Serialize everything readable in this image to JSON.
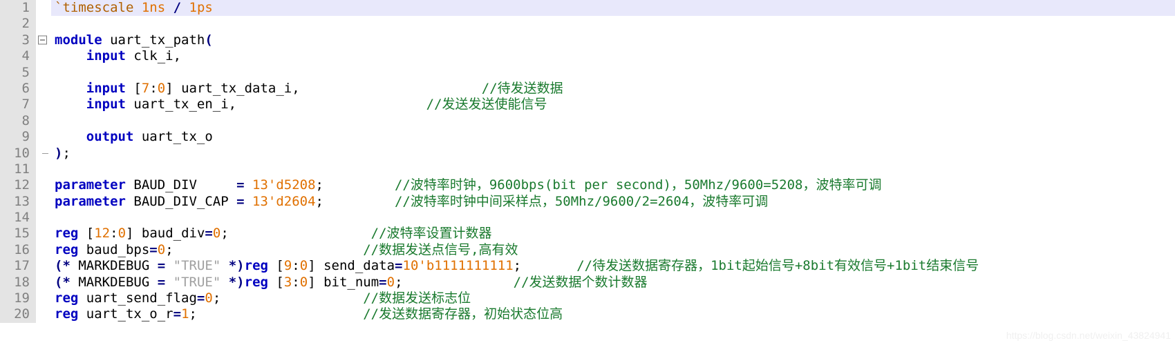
{
  "editor": {
    "language": "verilog",
    "colors": {
      "keyword": "#0000c0",
      "number": "#e07000",
      "comment": "#1a7a2e",
      "string": "#a0a0a0",
      "gutter_bg": "#e4e4e4",
      "gutter_fg": "#808080",
      "highlight_line_bg": "#e8e8fb",
      "background": "#ffffff"
    },
    "watermark": "https://blog.csdn.net/weixin_43824941",
    "lines": [
      {
        "number": "1",
        "highlight": true,
        "fold": "none",
        "tokens": [
          {
            "t": "tick",
            "v": "`timescale "
          },
          {
            "t": "num",
            "v": "1ns"
          },
          {
            "t": "plain",
            "v": " "
          },
          {
            "t": "op",
            "v": "/"
          },
          {
            "t": "plain",
            "v": " "
          },
          {
            "t": "num",
            "v": "1ps"
          }
        ]
      },
      {
        "number": "2",
        "highlight": false,
        "fold": "none",
        "tokens": []
      },
      {
        "number": "3",
        "highlight": false,
        "fold": "start",
        "tokens": [
          {
            "t": "kw",
            "v": "module"
          },
          {
            "t": "plain",
            "v": " uart_tx_path"
          },
          {
            "t": "op",
            "v": "("
          }
        ]
      },
      {
        "number": "4",
        "highlight": false,
        "fold": "mid",
        "tokens": [
          {
            "t": "plain",
            "v": "    "
          },
          {
            "t": "kw",
            "v": "input"
          },
          {
            "t": "plain",
            "v": " clk_i,"
          }
        ]
      },
      {
        "number": "5",
        "highlight": false,
        "fold": "mid",
        "tokens": []
      },
      {
        "number": "6",
        "highlight": false,
        "fold": "mid",
        "tokens": [
          {
            "t": "plain",
            "v": "    "
          },
          {
            "t": "kw",
            "v": "input"
          },
          {
            "t": "plain",
            "v": " ["
          },
          {
            "t": "num",
            "v": "7"
          },
          {
            "t": "plain",
            "v": ":"
          },
          {
            "t": "num",
            "v": "0"
          },
          {
            "t": "plain",
            "v": "] uart_tx_data_i,"
          },
          {
            "t": "pad",
            "v": 23
          },
          {
            "t": "comment",
            "v": "//待发送数据"
          }
        ]
      },
      {
        "number": "7",
        "highlight": false,
        "fold": "mid",
        "tokens": [
          {
            "t": "plain",
            "v": "    "
          },
          {
            "t": "kw",
            "v": "input"
          },
          {
            "t": "plain",
            "v": " uart_tx_en_i,"
          },
          {
            "t": "pad",
            "v": 24
          },
          {
            "t": "comment",
            "v": "//发送发送使能信号"
          }
        ]
      },
      {
        "number": "8",
        "highlight": false,
        "fold": "mid",
        "tokens": []
      },
      {
        "number": "9",
        "highlight": false,
        "fold": "mid",
        "tokens": [
          {
            "t": "plain",
            "v": "    "
          },
          {
            "t": "kw",
            "v": "output"
          },
          {
            "t": "plain",
            "v": " uart_tx_o"
          }
        ]
      },
      {
        "number": "10",
        "highlight": false,
        "fold": "end",
        "tokens": [
          {
            "t": "op",
            "v": ")"
          },
          {
            "t": "plain",
            "v": ";"
          }
        ]
      },
      {
        "number": "11",
        "highlight": false,
        "fold": "none",
        "tokens": []
      },
      {
        "number": "12",
        "highlight": false,
        "fold": "none",
        "tokens": [
          {
            "t": "kw",
            "v": "parameter"
          },
          {
            "t": "plain",
            "v": " BAUD_DIV     "
          },
          {
            "t": "op",
            "v": "="
          },
          {
            "t": "plain",
            "v": " "
          },
          {
            "t": "num",
            "v": "13'd5208"
          },
          {
            "t": "plain",
            "v": ";"
          },
          {
            "t": "pad",
            "v": 9
          },
          {
            "t": "comment",
            "v": "//波特率时钟，9600bps(bit per second)，50Mhz/9600=5208，波特率可调"
          }
        ]
      },
      {
        "number": "13",
        "highlight": false,
        "fold": "none",
        "tokens": [
          {
            "t": "kw",
            "v": "parameter"
          },
          {
            "t": "plain",
            "v": " BAUD_DIV_CAP "
          },
          {
            "t": "op",
            "v": "="
          },
          {
            "t": "plain",
            "v": " "
          },
          {
            "t": "num",
            "v": "13'd2604"
          },
          {
            "t": "plain",
            "v": ";"
          },
          {
            "t": "pad",
            "v": 9
          },
          {
            "t": "comment",
            "v": "//波特率时钟中间采样点，50Mhz/9600/2=2604，波特率可调"
          }
        ]
      },
      {
        "number": "14",
        "highlight": false,
        "fold": "none",
        "tokens": []
      },
      {
        "number": "15",
        "highlight": false,
        "fold": "none",
        "tokens": [
          {
            "t": "kw",
            "v": "reg"
          },
          {
            "t": "plain",
            "v": " ["
          },
          {
            "t": "num",
            "v": "12"
          },
          {
            "t": "plain",
            "v": ":"
          },
          {
            "t": "num",
            "v": "0"
          },
          {
            "t": "plain",
            "v": "] baud_div"
          },
          {
            "t": "op",
            "v": "="
          },
          {
            "t": "num",
            "v": "0"
          },
          {
            "t": "plain",
            "v": ";"
          },
          {
            "t": "pad",
            "v": 18
          },
          {
            "t": "comment",
            "v": "//波特率设置计数器"
          }
        ]
      },
      {
        "number": "16",
        "highlight": false,
        "fold": "none",
        "tokens": [
          {
            "t": "kw",
            "v": "reg"
          },
          {
            "t": "plain",
            "v": " baud_bps"
          },
          {
            "t": "op",
            "v": "="
          },
          {
            "t": "num",
            "v": "0"
          },
          {
            "t": "plain",
            "v": ";"
          },
          {
            "t": "pad",
            "v": 24
          },
          {
            "t": "comment",
            "v": "//数据发送点信号,高有效"
          }
        ]
      },
      {
        "number": "17",
        "highlight": false,
        "fold": "none",
        "tokens": [
          {
            "t": "op",
            "v": "(*"
          },
          {
            "t": "plain",
            "v": " MARKDEBUG "
          },
          {
            "t": "op",
            "v": "="
          },
          {
            "t": "plain",
            "v": " "
          },
          {
            "t": "str",
            "v": "\"TRUE\""
          },
          {
            "t": "plain",
            "v": " "
          },
          {
            "t": "op",
            "v": "*)"
          },
          {
            "t": "kw",
            "v": "reg"
          },
          {
            "t": "plain",
            "v": " ["
          },
          {
            "t": "num",
            "v": "9"
          },
          {
            "t": "plain",
            "v": ":"
          },
          {
            "t": "num",
            "v": "0"
          },
          {
            "t": "plain",
            "v": "] send_data"
          },
          {
            "t": "op",
            "v": "="
          },
          {
            "t": "num",
            "v": "10'b1111111111"
          },
          {
            "t": "plain",
            "v": ";"
          },
          {
            "t": "pad",
            "v": 7
          },
          {
            "t": "comment",
            "v": "//待发送数据寄存器，1bit起始信号+8bit有效信号+1bit结束信号"
          }
        ]
      },
      {
        "number": "18",
        "highlight": false,
        "fold": "none",
        "tokens": [
          {
            "t": "op",
            "v": "(*"
          },
          {
            "t": "plain",
            "v": " MARKDEBUG "
          },
          {
            "t": "op",
            "v": "="
          },
          {
            "t": "plain",
            "v": " "
          },
          {
            "t": "str",
            "v": "\"TRUE\""
          },
          {
            "t": "plain",
            "v": " "
          },
          {
            "t": "op",
            "v": "*)"
          },
          {
            "t": "kw",
            "v": "reg"
          },
          {
            "t": "plain",
            "v": " ["
          },
          {
            "t": "num",
            "v": "3"
          },
          {
            "t": "plain",
            "v": ":"
          },
          {
            "t": "num",
            "v": "0"
          },
          {
            "t": "plain",
            "v": "] bit_num"
          },
          {
            "t": "op",
            "v": "="
          },
          {
            "t": "num",
            "v": "0"
          },
          {
            "t": "plain",
            "v": ";"
          },
          {
            "t": "pad",
            "v": 14
          },
          {
            "t": "comment",
            "v": "//发送数据个数计数器"
          }
        ]
      },
      {
        "number": "19",
        "highlight": false,
        "fold": "none",
        "tokens": [
          {
            "t": "kw",
            "v": "reg"
          },
          {
            "t": "plain",
            "v": " uart_send_flag"
          },
          {
            "t": "op",
            "v": "="
          },
          {
            "t": "num",
            "v": "0"
          },
          {
            "t": "plain",
            "v": ";"
          },
          {
            "t": "pad",
            "v": 18
          },
          {
            "t": "comment",
            "v": "//数据发送标志位"
          }
        ]
      },
      {
        "number": "20",
        "highlight": false,
        "fold": "none",
        "tokens": [
          {
            "t": "kw",
            "v": "reg"
          },
          {
            "t": "plain",
            "v": " uart_tx_o_r"
          },
          {
            "t": "op",
            "v": "="
          },
          {
            "t": "num",
            "v": "1"
          },
          {
            "t": "plain",
            "v": ";"
          },
          {
            "t": "pad",
            "v": 21
          },
          {
            "t": "comment",
            "v": "//发送数据寄存器，初始状态位高"
          }
        ]
      }
    ]
  }
}
